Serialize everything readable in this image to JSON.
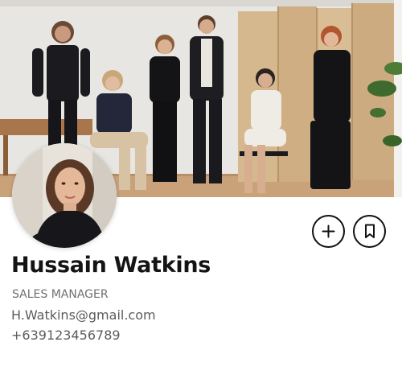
{
  "profile": {
    "name": "Hussain Watkins",
    "role": "SALES MANAGER",
    "email": "H.Watkins@gmail.com",
    "phone": "+639123456789"
  },
  "actions": {
    "add_icon": "plus-icon",
    "bookmark_icon": "bookmark-icon"
  },
  "colors": {
    "text_dark": "#141414",
    "text_muted": "#5c5c5c",
    "button_border": "#111111"
  }
}
